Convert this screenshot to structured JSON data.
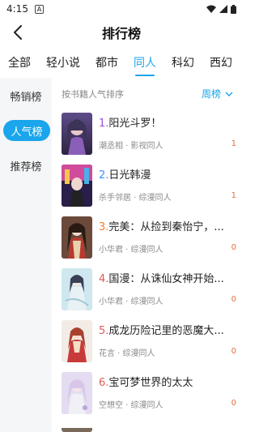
{
  "status": {
    "time": "4:15",
    "a_badge": "A"
  },
  "header": {
    "title": "排行榜"
  },
  "tabs": [
    "全部",
    "轻小说",
    "都市",
    "同人",
    "科幻",
    "西幻"
  ],
  "sidebar": [
    "畅销榜",
    "人气榜",
    "推荐榜"
  ],
  "content": {
    "sort_hint": "按书籍人气排序",
    "period": "周榜"
  },
  "books": [
    {
      "rank": "1.",
      "title": "阳光斗罗！",
      "meta": "潮丞相 · 影视同人",
      "count": "1",
      "rank_color": "#9b4fe0",
      "count_color": "#e0703a"
    },
    {
      "rank": "2.",
      "title": "日光韩漫",
      "meta": "杀手邻居 · 综漫同人",
      "count": "1",
      "rank_color": "#3c8bff",
      "count_color": "#e0703a"
    },
    {
      "rank": "3.",
      "title": "完美：从捡到秦怡宁，...",
      "meta": "小华君 · 综漫同人",
      "count": "0",
      "rank_color": "#ff7a2f",
      "count_color": "#e0703a"
    },
    {
      "rank": "4.",
      "title": "国漫：从诛仙女神开始...",
      "meta": "小华君 · 综漫同人",
      "count": "0",
      "rank_color": "#e05a5a",
      "count_color": "#e0703a"
    },
    {
      "rank": "5.",
      "title": "成龙历险记里的恶魔大...",
      "meta": "花言 · 综漫同人",
      "count": "0",
      "rank_color": "#e05a5a",
      "count_color": "#e0703a"
    },
    {
      "rank": "6.",
      "title": "宝可梦世界的太太",
      "meta": "空想空 · 综漫同人",
      "count": "0",
      "rank_color": "#e05a5a",
      "count_color": "#e0703a"
    }
  ]
}
